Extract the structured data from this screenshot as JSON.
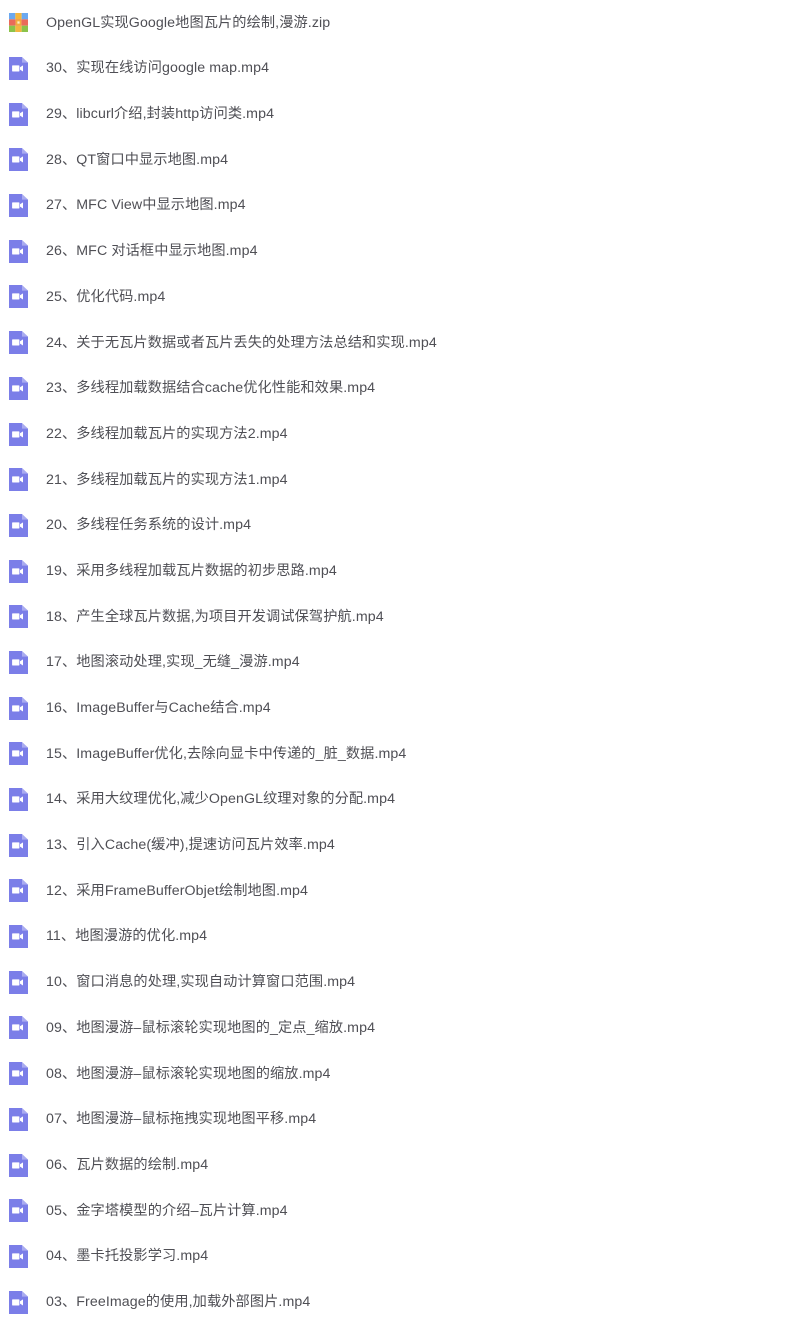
{
  "view": {
    "type": "file-listing",
    "background_color": "#ffffff",
    "text_color": "#4f4f55",
    "video_icon_color": "#7b7ee8",
    "zip_icon_colors": {
      "blue": "#6aa8f0",
      "red": "#ea6a5a",
      "green": "#8bc34a",
      "yellow": "#f4b63f",
      "orange": "#f08a3c"
    },
    "item_count": 29
  },
  "files": [
    {
      "name": "OpenGL实现Google地图瓦片的绘制,漫游.zip",
      "icon": "zip-archive-icon",
      "type": "zip"
    },
    {
      "name": "30、实现在线访问google map.mp4",
      "icon": "video-file-icon",
      "type": "mp4"
    },
    {
      "name": "29、libcurl介绍,封装http访问类.mp4",
      "icon": "video-file-icon",
      "type": "mp4"
    },
    {
      "name": "28、QT窗口中显示地图.mp4",
      "icon": "video-file-icon",
      "type": "mp4"
    },
    {
      "name": "27、MFC View中显示地图.mp4",
      "icon": "video-file-icon",
      "type": "mp4"
    },
    {
      "name": "26、MFC 对话框中显示地图.mp4",
      "icon": "video-file-icon",
      "type": "mp4"
    },
    {
      "name": "25、优化代码.mp4",
      "icon": "video-file-icon",
      "type": "mp4"
    },
    {
      "name": "24、关于无瓦片数据或者瓦片丢失的处理方法总结和实现.mp4",
      "icon": "video-file-icon",
      "type": "mp4"
    },
    {
      "name": "23、多线程加载数据结合cache优化性能和效果.mp4",
      "icon": "video-file-icon",
      "type": "mp4"
    },
    {
      "name": "22、多线程加载瓦片的实现方法2.mp4",
      "icon": "video-file-icon",
      "type": "mp4"
    },
    {
      "name": "21、多线程加载瓦片的实现方法1.mp4",
      "icon": "video-file-icon",
      "type": "mp4"
    },
    {
      "name": "20、多线程任务系统的设计.mp4",
      "icon": "video-file-icon",
      "type": "mp4"
    },
    {
      "name": "19、采用多线程加载瓦片数据的初步思路.mp4",
      "icon": "video-file-icon",
      "type": "mp4"
    },
    {
      "name": "18、产生全球瓦片数据,为项目开发调试保驾护航.mp4",
      "icon": "video-file-icon",
      "type": "mp4"
    },
    {
      "name": "17、地图滚动处理,实现_无缝_漫游.mp4",
      "icon": "video-file-icon",
      "type": "mp4"
    },
    {
      "name": "16、ImageBuffer与Cache结合.mp4",
      "icon": "video-file-icon",
      "type": "mp4"
    },
    {
      "name": "15、ImageBuffer优化,去除向显卡中传递的_脏_数据.mp4",
      "icon": "video-file-icon",
      "type": "mp4"
    },
    {
      "name": "14、采用大纹理优化,减少OpenGL纹理对象的分配.mp4",
      "icon": "video-file-icon",
      "type": "mp4"
    },
    {
      "name": "13、引入Cache(缓冲),提速访问瓦片效率.mp4",
      "icon": "video-file-icon",
      "type": "mp4"
    },
    {
      "name": "12、采用FrameBufferObjet绘制地图.mp4",
      "icon": "video-file-icon",
      "type": "mp4"
    },
    {
      "name": "11、地图漫游的优化.mp4",
      "icon": "video-file-icon",
      "type": "mp4"
    },
    {
      "name": "10、窗口消息的处理,实现自动计算窗口范围.mp4",
      "icon": "video-file-icon",
      "type": "mp4"
    },
    {
      "name": "09、地图漫游–鼠标滚轮实现地图的_定点_缩放.mp4",
      "icon": "video-file-icon",
      "type": "mp4"
    },
    {
      "name": "08、地图漫游–鼠标滚轮实现地图的缩放.mp4",
      "icon": "video-file-icon",
      "type": "mp4"
    },
    {
      "name": "07、地图漫游–鼠标拖拽实现地图平移.mp4",
      "icon": "video-file-icon",
      "type": "mp4"
    },
    {
      "name": "06、瓦片数据的绘制.mp4",
      "icon": "video-file-icon",
      "type": "mp4"
    },
    {
      "name": "05、金字塔模型的介绍–瓦片计算.mp4",
      "icon": "video-file-icon",
      "type": "mp4"
    },
    {
      "name": "04、墨卡托投影学习.mp4",
      "icon": "video-file-icon",
      "type": "mp4"
    },
    {
      "name": "03、FreeImage的使用,加载外部图片.mp4",
      "icon": "video-file-icon",
      "type": "mp4"
    }
  ]
}
